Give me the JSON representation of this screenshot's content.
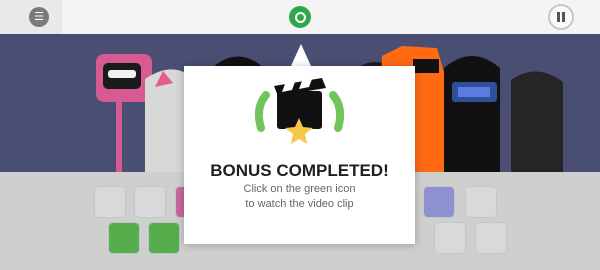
{
  "app": {
    "menu_glyph": "☰",
    "bonus_popup": {
      "title": "BONUS COMPLETED!",
      "message_line1": "Click on the green icon",
      "message_line2": "to watch the video clip"
    }
  }
}
